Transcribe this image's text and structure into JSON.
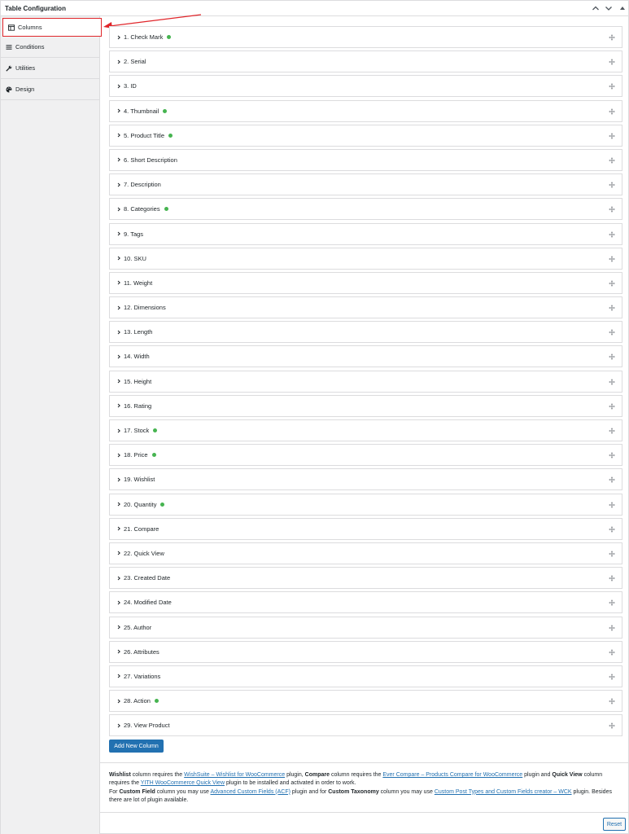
{
  "panel": {
    "title": "Table Configuration"
  },
  "sidebar": {
    "items": [
      {
        "label": "Columns",
        "icon": "table-columns-icon",
        "active": true
      },
      {
        "label": "Conditions",
        "icon": "list-lines-icon",
        "active": false
      },
      {
        "label": "Utilities",
        "icon": "wrench-icon",
        "active": false
      },
      {
        "label": "Design",
        "icon": "palette-icon",
        "active": false
      }
    ]
  },
  "columns": [
    {
      "label": "1. Check Mark",
      "enabled": true
    },
    {
      "label": "2. Serial",
      "enabled": false
    },
    {
      "label": "3. ID",
      "enabled": false
    },
    {
      "label": "4. Thumbnail",
      "enabled": true
    },
    {
      "label": "5. Product Title",
      "enabled": true
    },
    {
      "label": "6. Short Description",
      "enabled": false
    },
    {
      "label": "7. Description",
      "enabled": false
    },
    {
      "label": "8. Categories",
      "enabled": true
    },
    {
      "label": "9. Tags",
      "enabled": false
    },
    {
      "label": "10. SKU",
      "enabled": false
    },
    {
      "label": "11. Weight",
      "enabled": false
    },
    {
      "label": "12. Dimensions",
      "enabled": false
    },
    {
      "label": "13. Length",
      "enabled": false
    },
    {
      "label": "14. Width",
      "enabled": false
    },
    {
      "label": "15. Height",
      "enabled": false
    },
    {
      "label": "16. Rating",
      "enabled": false
    },
    {
      "label": "17. Stock",
      "enabled": true
    },
    {
      "label": "18. Price",
      "enabled": true
    },
    {
      "label": "19. Wishlist",
      "enabled": false
    },
    {
      "label": "20. Quantity",
      "enabled": true
    },
    {
      "label": "21. Compare",
      "enabled": false
    },
    {
      "label": "22. Quick View",
      "enabled": false
    },
    {
      "label": "23. Created Date",
      "enabled": false
    },
    {
      "label": "24. Modified Date",
      "enabled": false
    },
    {
      "label": "25. Author",
      "enabled": false
    },
    {
      "label": "26. Attributes",
      "enabled": false
    },
    {
      "label": "27. Variations",
      "enabled": false
    },
    {
      "label": "28. Action",
      "enabled": true
    },
    {
      "label": "29. View Product",
      "enabled": false
    }
  ],
  "buttons": {
    "add_column": "Add New Column",
    "reset": "Reset"
  },
  "notice": {
    "t1": "Wishlist",
    "t2": " column requires the ",
    "link1": "WishSuite – Wishlist for WooCommerce",
    "t3": " plugin, ",
    "t4": "Compare",
    "t5": " column requires the ",
    "link2": "Ever Compare – Products Compare for WooCommerce",
    "t6": " plugin and ",
    "t7": "Quick View",
    "t8": " column requires the ",
    "link3": "YITH WooCommerce Quick View",
    "t9": " plugin to be installed and activated in order to work.",
    "t10": "For ",
    "t11": "Custom Field",
    "t12": " column you may use ",
    "link4": "Advanced Custom Fields (ACF)",
    "t13": " plugin and for ",
    "t14": "Custom Taxonomy",
    "t15": " column you may use ",
    "link5": "Custom Post Types and Custom Fields creator – WCK",
    "t16": " plugin. Besides there are lot of plugin available."
  },
  "colors": {
    "accent": "#2271b1",
    "enabled_dot": "#46b450",
    "highlight": "#e0262b"
  }
}
